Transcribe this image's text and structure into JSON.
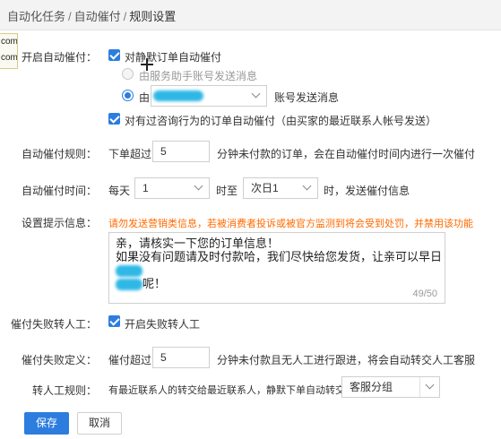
{
  "breadcrumb": {
    "item1": "自动化任务",
    "sep1": "/",
    "item2": "自动催付",
    "sep2": "/",
    "current": "规则设置"
  },
  "edge_tab": {
    "line1": "com",
    "line2": "com"
  },
  "auto_remind": {
    "label": "开启自动催付：",
    "checkbox_label": "对静默订单自动催付",
    "radio1_label": "由服务助手账号发送消息",
    "radio2_prefix": "由",
    "radio2_suffix": "账号发送消息",
    "checkbox2_label": "对有过咨询行为的订单自动催付（由买家的最近联系人帐号发送）"
  },
  "rule": {
    "label": "自动催付规则：",
    "prefix": "下单超过",
    "value": "5",
    "suffix": "分钟未付款的订单，会在自动催付时间内进行一次催付"
  },
  "time": {
    "label": "自动催付时间：",
    "prefix": "每天",
    "start_value": "1",
    "middle": "时至",
    "end_value": "次日1",
    "suffix": "时，发送催付信息"
  },
  "message": {
    "label": "设置提示信息：",
    "warning": "请勿发送营销类信息，若被消费者投诉或被官方监测到将会受到处罚，并禁用该功能",
    "line1": "亲，请核实一下您的订单信息！",
    "line2_prefix": "如果没有问题请及时付款哈，我们尽快给您发货，让亲可以早日",
    "line3_suffix": "呢！",
    "counter": "49/50"
  },
  "fail_transfer": {
    "label": "催付失败转人工：",
    "checkbox_label": "开启失败转人工"
  },
  "fail_define": {
    "label": "催付失败定义：",
    "prefix": "催付超过",
    "value": "5",
    "suffix": "分钟未付款且无人工进行跟进，将会自动转交人工客服"
  },
  "transfer_rule": {
    "label": "转人工规则：",
    "text": "有最近联系人的转交给最近联系人，静默下单自动转交给",
    "select_value": "客服分组"
  },
  "buttons": {
    "save": "保存",
    "cancel": "取消"
  },
  "colors": {
    "primary": "#2d7ddf",
    "warning": "#ff6a00",
    "redacted": "#2fb8e6"
  }
}
